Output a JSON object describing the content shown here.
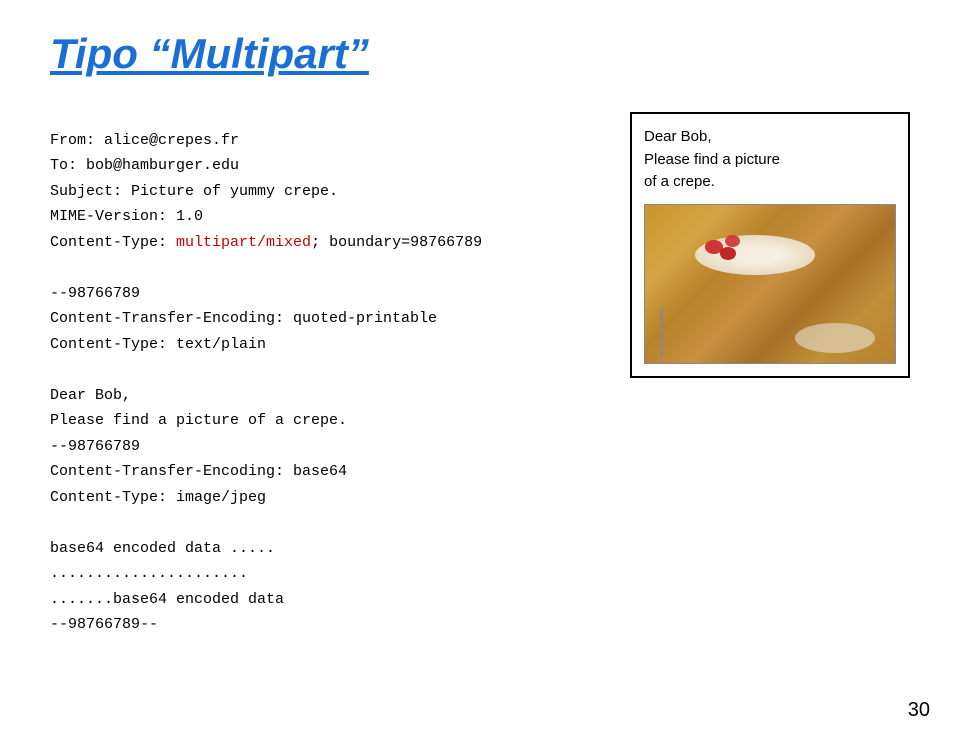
{
  "slide": {
    "title": "Tipo “Multipart”",
    "page_number": "30"
  },
  "left_column": {
    "lines": [
      {
        "text": "From: alice@crepes.fr",
        "highlight": false
      },
      {
        "text": "To: bob@hamburger.edu",
        "highlight": false
      },
      {
        "text": "Subject: Picture of yummy crepe.",
        "highlight": false
      },
      {
        "text": "MIME-Version: 1.0",
        "highlight": false
      },
      {
        "text": "Content-Type: ",
        "highlight": false,
        "inline_highlight": "multipart/mixed",
        "suffix": "; boundary=98766789"
      },
      {
        "text": "",
        "highlight": false
      },
      {
        "text": "--98766789",
        "highlight": false
      },
      {
        "text": "Content-Transfer-Encoding: quoted-printable",
        "highlight": false
      },
      {
        "text": "Content-Type: text/plain",
        "highlight": false
      },
      {
        "text": "",
        "highlight": false
      },
      {
        "text": "Dear Bob,",
        "highlight": false
      },
      {
        "text": "Please find a picture of a crepe.",
        "highlight": false
      },
      {
        "text": "--98766789",
        "highlight": false
      },
      {
        "text": "Content-Transfer-Encoding: base64",
        "highlight": false
      },
      {
        "text": "Content-Type: image/jpeg",
        "highlight": false
      },
      {
        "text": "",
        "highlight": false
      },
      {
        "text": "base64 encoded data .....",
        "highlight": false
      },
      {
        "text": "......................",
        "highlight": false
      },
      {
        "text": ".......base64 encoded data",
        "highlight": false
      },
      {
        "text": "--98766789--",
        "highlight": false
      }
    ]
  },
  "right_column": {
    "text_lines": [
      "Dear Bob,",
      "Please find a picture",
      "of a crepe."
    ],
    "image_alt": "crepe photo"
  }
}
